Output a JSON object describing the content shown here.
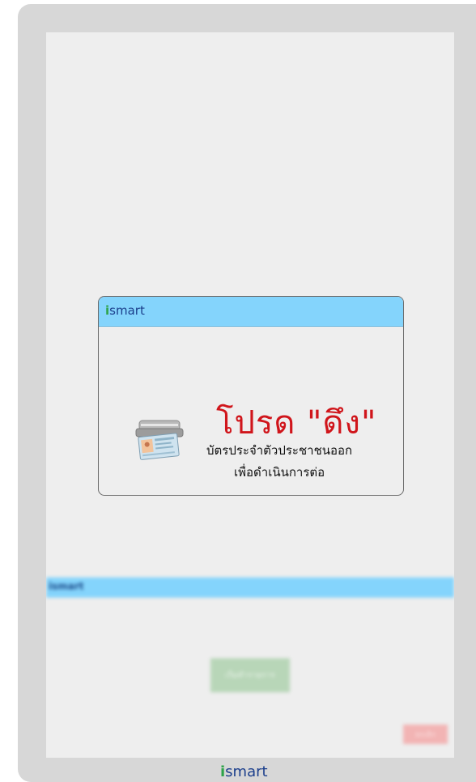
{
  "background_app": {
    "logo_i": "i",
    "logo_rest": "smart",
    "primary_button_label": "เริ่มทำรายการ",
    "cancel_button_label": "ยกเลิก"
  },
  "dialog": {
    "logo_i": "i",
    "logo_rest": "smart",
    "title": "โปรด \"ดึง\"",
    "line1": "บัตรประจำตัวประชาชนออก",
    "line2": "เพื่อดำเนินการต่อ",
    "icon": "card-reader-icon"
  },
  "footer": {
    "logo_i": "i",
    "logo_rest": "smart"
  },
  "colors": {
    "header_blue": "#84d4fc",
    "title_red": "#d0151b",
    "logo_green": "#2fa44a",
    "logo_blue": "#1c3f8c"
  }
}
